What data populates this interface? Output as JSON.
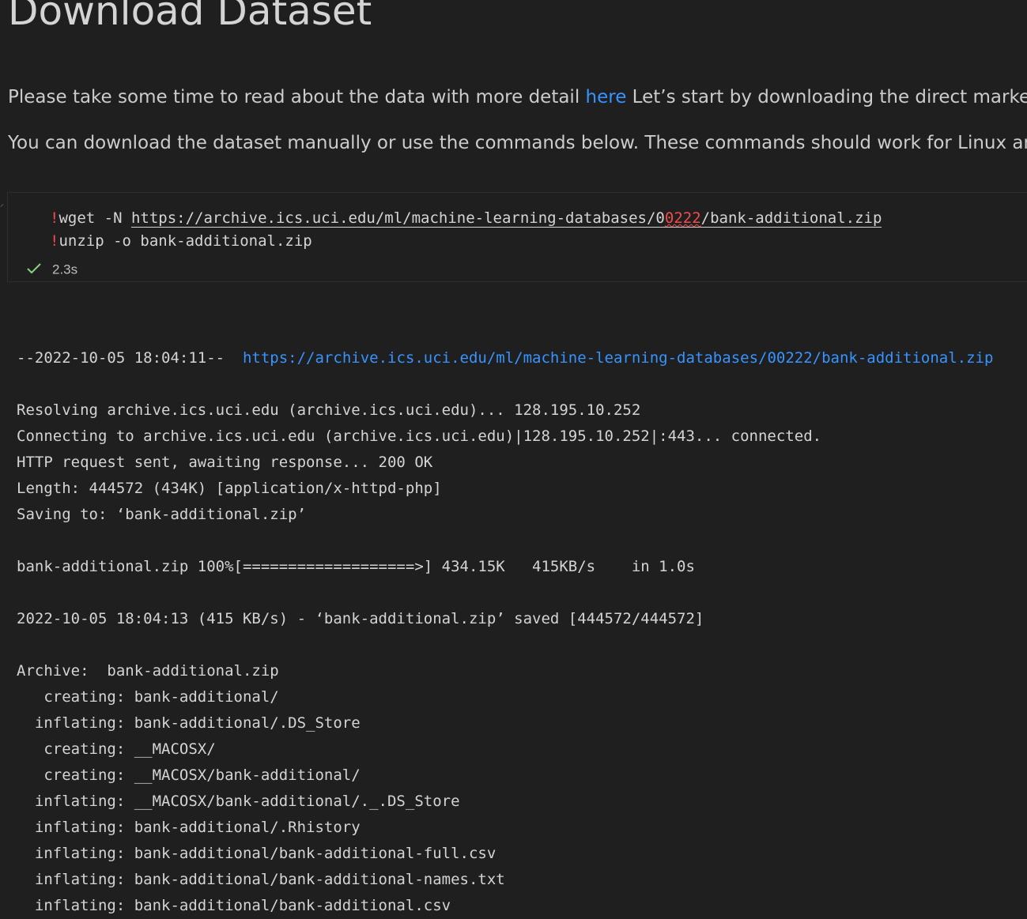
{
  "heading": "Download Dataset",
  "paragraph1": {
    "before": "Please take some time to read about the data with more detail ",
    "link": "here",
    "after": " Let’s start by downloading the direct marketing"
  },
  "paragraph2": "You can download the dataset manually or use the commands below. These commands should work for Linux and M",
  "cell": {
    "line1": {
      "bang": "!",
      "cmd": "wget -N ",
      "url_a": "https://archive.ics.uci.edu/ml/machine-learning-databases/0",
      "url_err": "0222",
      "url_b": "/bank-additional.zip"
    },
    "line2": {
      "bang": "!",
      "cmd": "unzip -o bank-additional.zip"
    },
    "status_icon": "check-icon",
    "exec_time": "2.3s"
  },
  "output": {
    "first_prefix": "--2022-10-05 18:04:11--  ",
    "first_link": "https://archive.ics.uci.edu/ml/machine-learning-databases/00222/bank-additional.zip",
    "lines": [
      "Resolving archive.ics.uci.edu (archive.ics.uci.edu)... 128.195.10.252",
      "Connecting to archive.ics.uci.edu (archive.ics.uci.edu)|128.195.10.252|:443... connected.",
      "HTTP request sent, awaiting response... 200 OK",
      "Length: 444572 (434K) [application/x-httpd-php]",
      "Saving to: ‘bank-additional.zip’",
      "",
      "bank-additional.zip 100%[===================>] 434.15K   415KB/s    in 1.0s",
      "",
      "2022-10-05 18:04:13 (415 KB/s) - ‘bank-additional.zip’ saved [444572/444572]",
      "",
      "Archive:  bank-additional.zip",
      "   creating: bank-additional/",
      "  inflating: bank-additional/.DS_Store",
      "   creating: __MACOSX/",
      "   creating: __MACOSX/bank-additional/",
      "  inflating: __MACOSX/bank-additional/._.DS_Store",
      "  inflating: bank-additional/.Rhistory",
      "  inflating: bank-additional/bank-additional-full.csv",
      "  inflating: bank-additional/bank-additional-names.txt",
      "  inflating: bank-additional/bank-additional.csv"
    ]
  }
}
